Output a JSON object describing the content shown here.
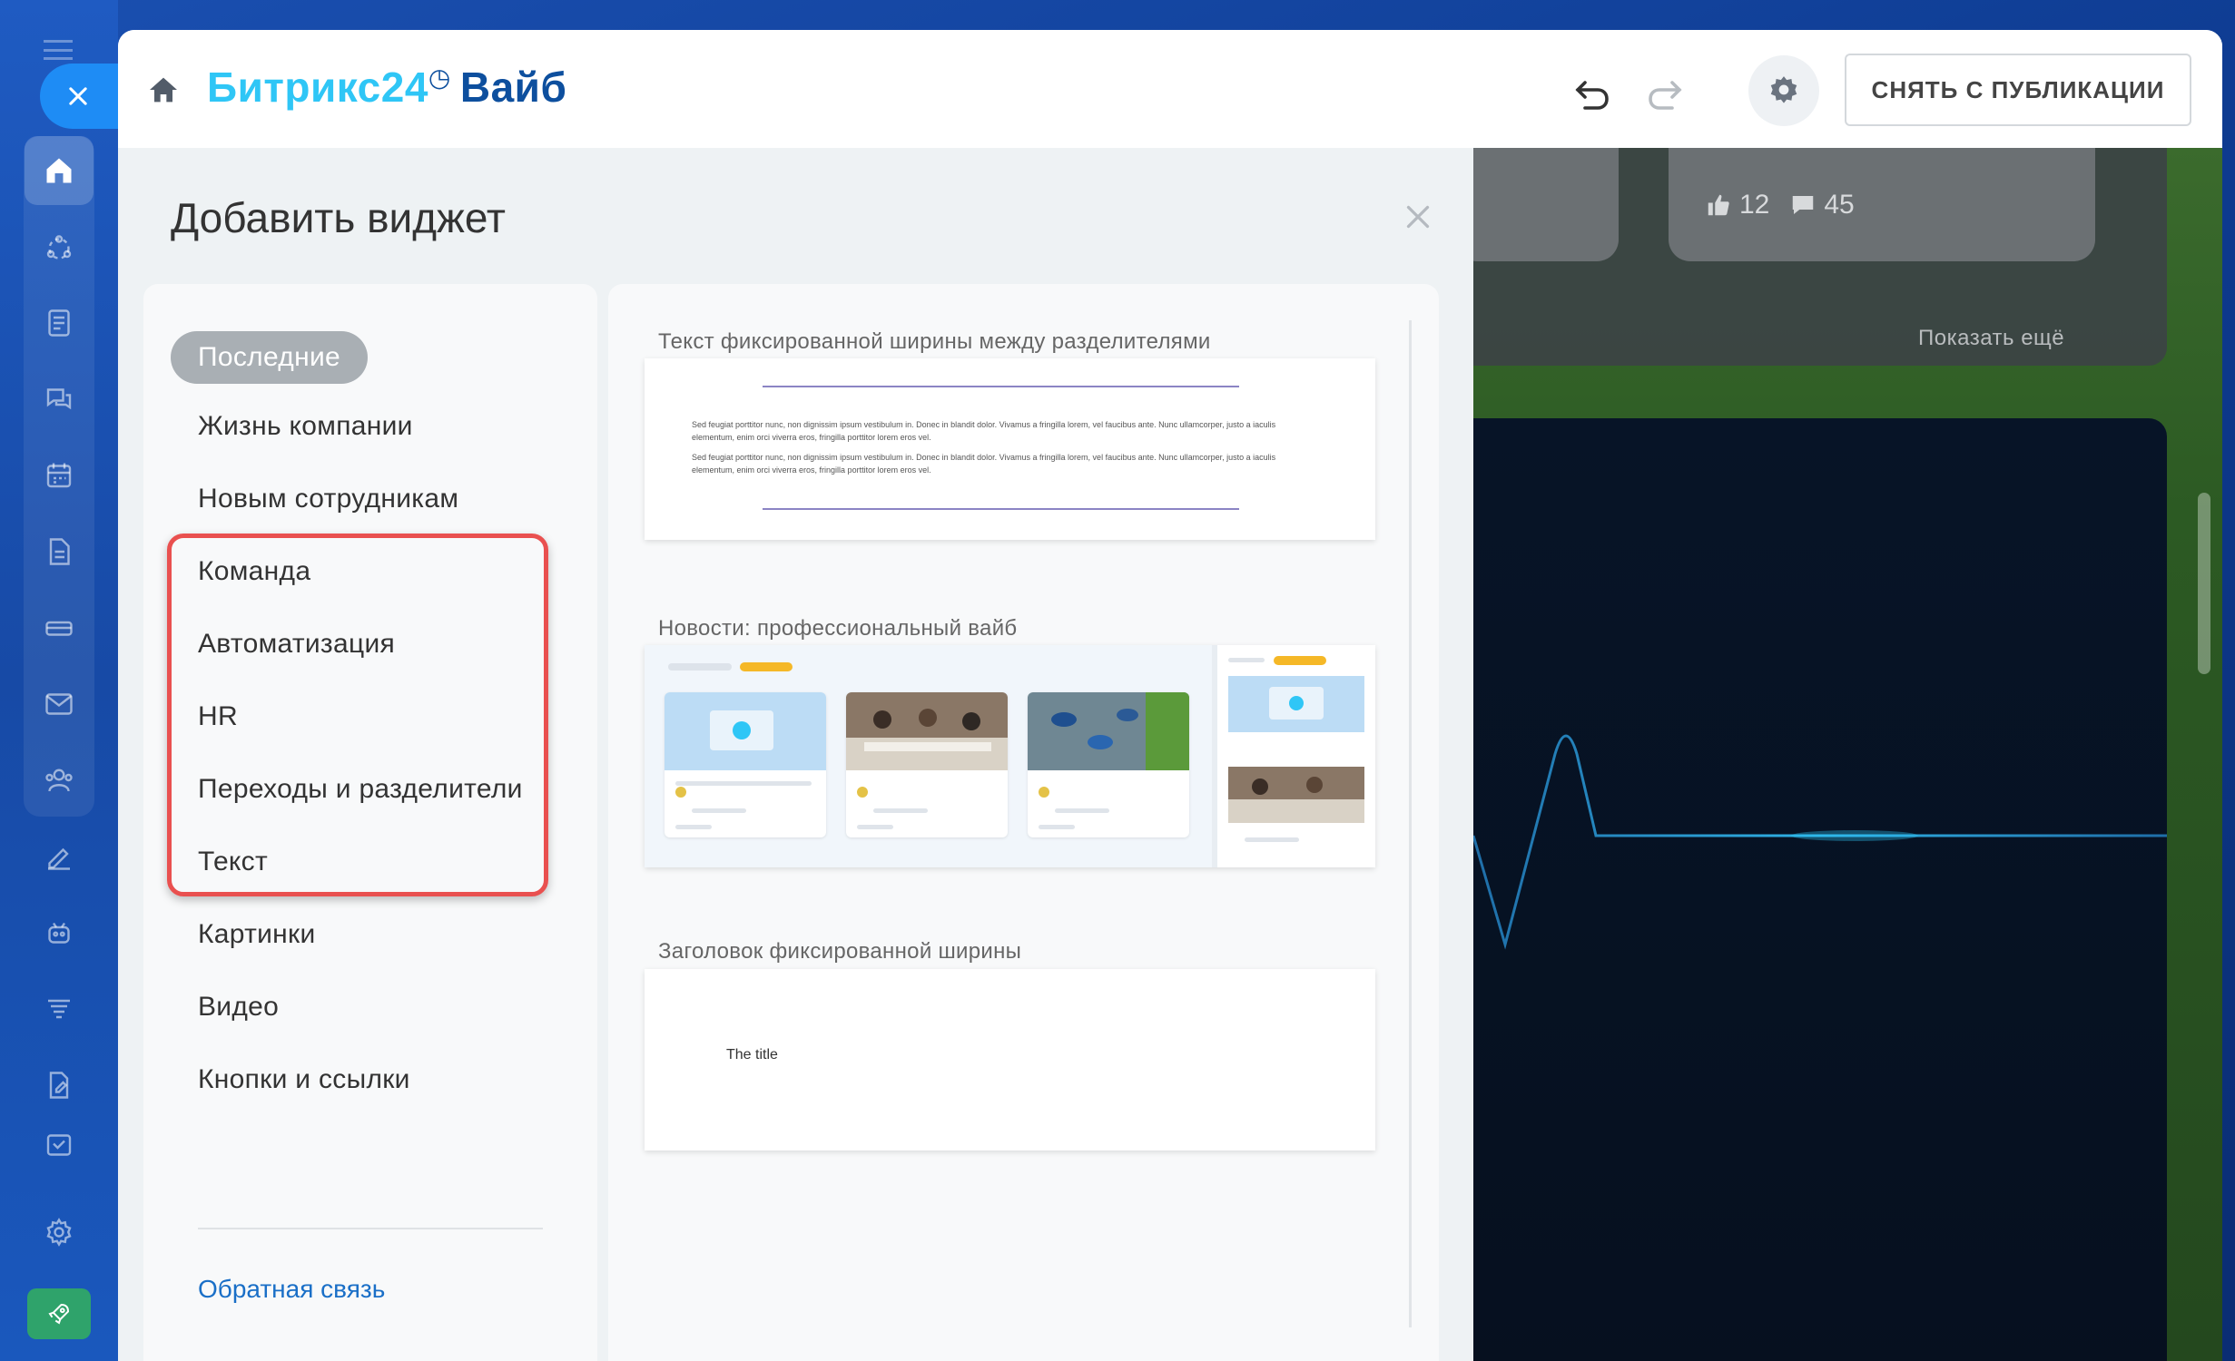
{
  "app": {
    "brand_name": "Битрикс24",
    "brand_clock": "◷",
    "brand_suffix": "Вайб"
  },
  "toolbar": {
    "unpublish_label": "СНЯТЬ С ПУБЛИКАЦИИ"
  },
  "panel": {
    "title": "Добавить виджет",
    "categories": [
      {
        "label": "Последние",
        "selected": true
      },
      {
        "label": "Жизнь компании"
      },
      {
        "label": "Новым сотрудникам"
      },
      {
        "label": "Команда"
      },
      {
        "label": "Автоматизация"
      },
      {
        "label": "HR"
      },
      {
        "label": "Переходы и разделители"
      },
      {
        "label": "Текст"
      },
      {
        "label": "Картинки"
      },
      {
        "label": "Видео"
      },
      {
        "label": "Кнопки и ссылки"
      }
    ],
    "feedback_label": "Обратная связь",
    "widgets": [
      {
        "caption": "Текст фиксированной ширины между разделителями",
        "sample_text": "Sed feugiat porttitor nunc, non dignissim ipsum vestibulum in. Donec in blandit dolor. Vivamus a fringilla lorem, vel faucibus ante. Nunc ullamcorper, justo a iaculis elementum, enim orci viverra eros, fringilla porttitor lorem eros vel."
      },
      {
        "caption": "Новости: профессиональный вайб"
      },
      {
        "caption": "Заголовок фиксированной ширины",
        "sample_title": "The title"
      }
    ]
  },
  "preview": {
    "likes": "12",
    "comments": "45",
    "show_more": "Показать ещё"
  },
  "colors": {
    "brand_cyan": "#2fc6f6",
    "brand_navy": "#0d4f9e",
    "highlight_red": "#e9504f",
    "link_blue": "#1a6fc7",
    "selected_pill": "#a9afb4"
  },
  "icons": [
    "hamburger-icon",
    "close-icon",
    "home-icon",
    "undo-icon",
    "redo-icon",
    "gear-icon",
    "like-icon",
    "comment-icon"
  ]
}
